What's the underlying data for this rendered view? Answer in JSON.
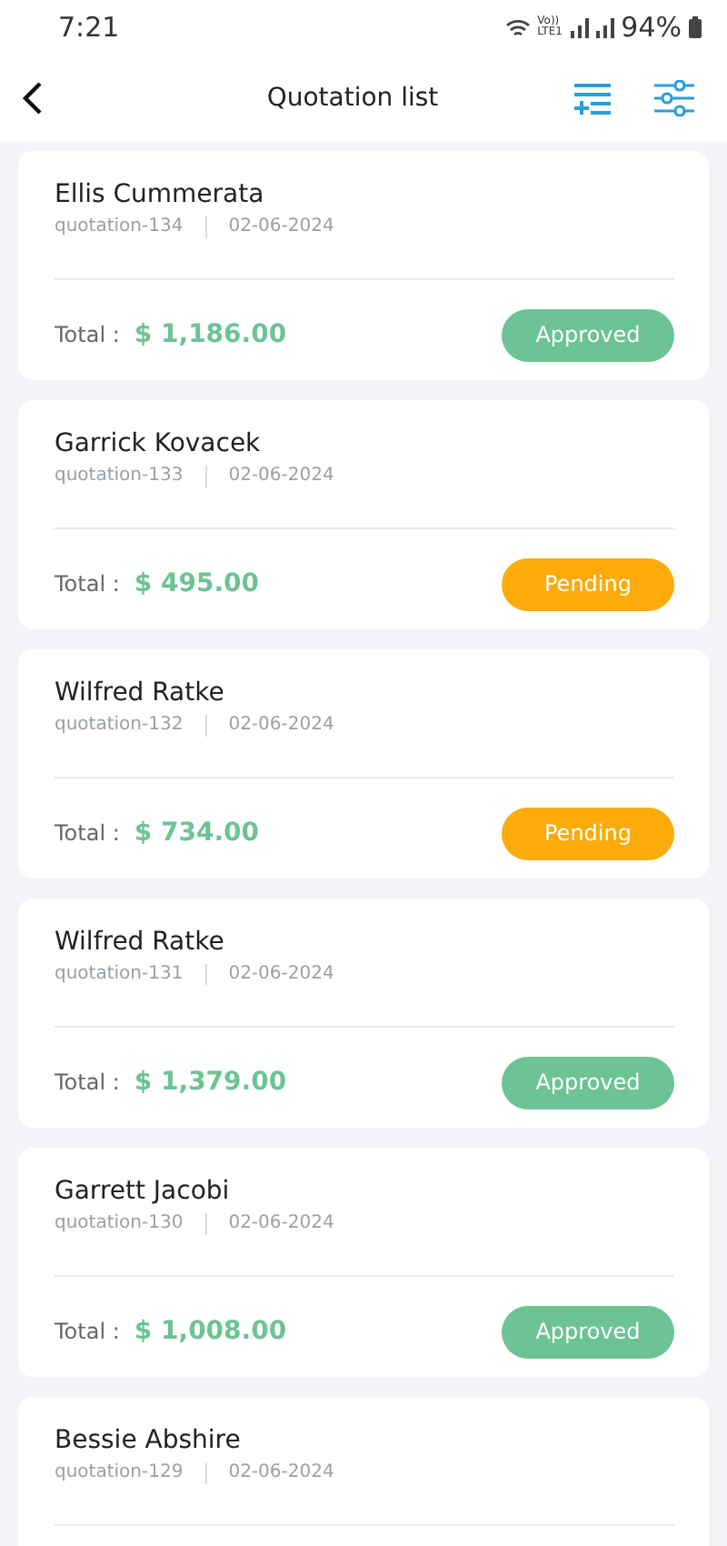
{
  "status_bar": {
    "time": "7:21",
    "battery": "94%",
    "network_label": "Vo)) LTE1"
  },
  "header": {
    "title": "Quotation list"
  },
  "quotations": [
    {
      "customer": "Ellis Cummerata",
      "number": "quotation-134",
      "date": "02-06-2024",
      "total_label": "Total :",
      "total": "$ 1,186.00",
      "status": {
        "label": "Approved",
        "kind": "approved"
      }
    },
    {
      "customer": "Garrick Kovacek",
      "number": "quotation-133",
      "date": "02-06-2024",
      "total_label": "Total :",
      "total": "$ 495.00",
      "status": {
        "label": "Pending",
        "kind": "pending"
      }
    },
    {
      "customer": "Wilfred Ratke",
      "number": "quotation-132",
      "date": "02-06-2024",
      "total_label": "Total :",
      "total": "$ 734.00",
      "status": {
        "label": "Pending",
        "kind": "pending"
      }
    },
    {
      "customer": "Wilfred Ratke",
      "number": "quotation-131",
      "date": "02-06-2024",
      "total_label": "Total :",
      "total": "$ 1,379.00",
      "status": {
        "label": "Approved",
        "kind": "approved"
      }
    },
    {
      "customer": "Garrett Jacobi",
      "number": "quotation-130",
      "date": "02-06-2024",
      "total_label": "Total :",
      "total": "$ 1,008.00",
      "status": {
        "label": "Approved",
        "kind": "approved"
      }
    },
    {
      "customer": "Bessie Abshire",
      "number": "quotation-129",
      "date": "02-06-2024"
    }
  ]
}
